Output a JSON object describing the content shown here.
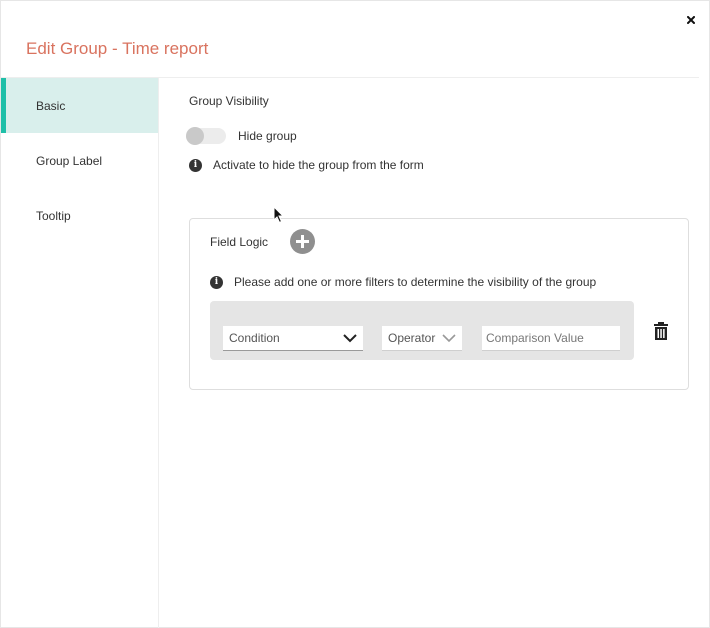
{
  "dialog": {
    "title": "Edit Group - Time report",
    "close_icon": "close-icon"
  },
  "sidebar": {
    "items": [
      {
        "label": "Basic",
        "active": true
      },
      {
        "label": "Group Label",
        "active": false
      },
      {
        "label": "Tooltip",
        "active": false
      }
    ]
  },
  "visibility": {
    "section_title": "Group Visibility",
    "toggle_label": "Hide group",
    "toggle_on": false,
    "info_text": "Activate to hide the group from the form"
  },
  "field_logic": {
    "title": "Field Logic",
    "add_icon": "plus-circle-icon",
    "info_text": "Please add one or more filters to determine the visibility of the group",
    "filters": [
      {
        "condition_placeholder": "Condition",
        "operator_placeholder": "Operator",
        "comparison_placeholder": "Comparison Value"
      }
    ],
    "delete_icon": "trash-icon"
  },
  "colors": {
    "title": "#d9735f",
    "accent": "#1fbfa8",
    "active_bg": "#d9efec"
  }
}
